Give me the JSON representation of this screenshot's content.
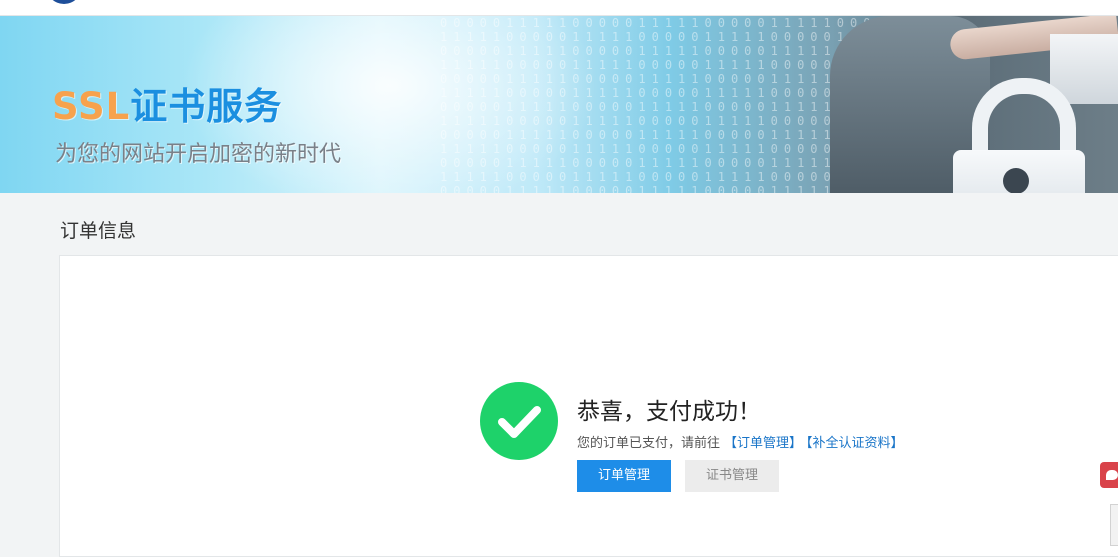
{
  "banner": {
    "title_latin": "SSL",
    "title_cn": "证书服务",
    "subtitle": "为您的网站开启加密的新时代"
  },
  "section": {
    "title": "订单信息"
  },
  "result": {
    "title": "恭喜，支付成功！",
    "message_prefix": "您的订单已支付，请前往",
    "link_order": "【订单管理】",
    "link_info": "【补全认证资料】"
  },
  "buttons": {
    "order_manage": "订单管理",
    "cert_manage": "证书管理"
  },
  "colors": {
    "accent": "#1e8de8",
    "success": "#1ed26a",
    "link": "#1a75c8"
  },
  "icons": {
    "success": "check-circle-icon"
  }
}
